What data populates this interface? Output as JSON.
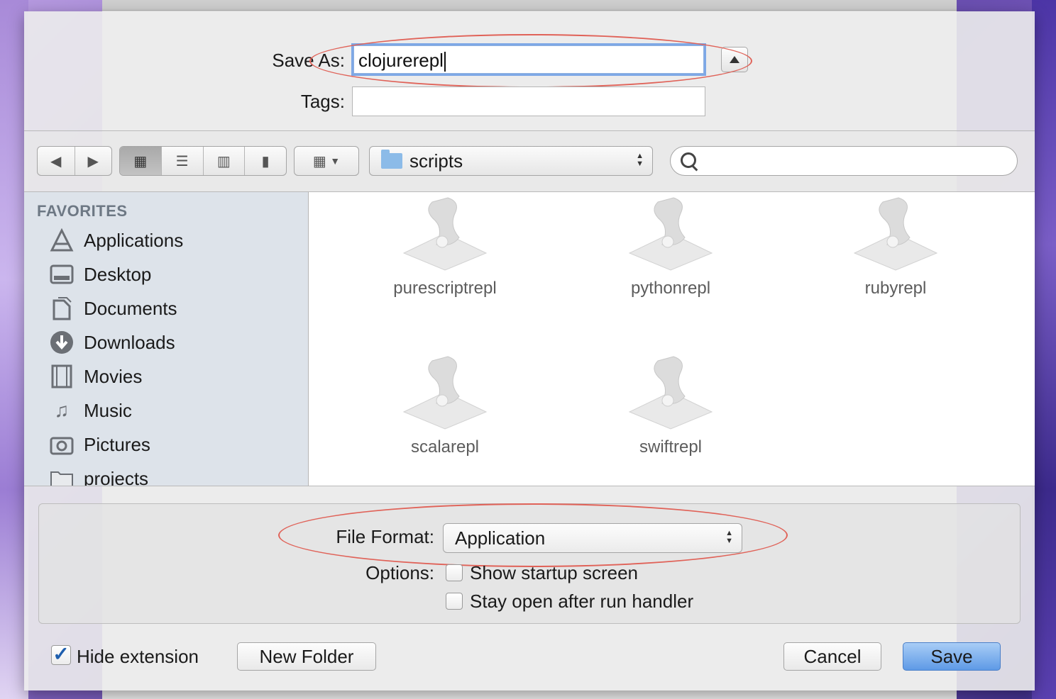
{
  "dialog": {
    "save_as_label": "Save As:",
    "save_as_value": "clojurerepl",
    "tags_label": "Tags:",
    "tags_value": ""
  },
  "toolbar": {
    "path_folder": "scripts",
    "search_placeholder": ""
  },
  "sidebar": {
    "header": "FAVORITES",
    "items": [
      {
        "label": "Applications",
        "icon": "applications-icon"
      },
      {
        "label": "Desktop",
        "icon": "desktop-icon"
      },
      {
        "label": "Documents",
        "icon": "documents-icon"
      },
      {
        "label": "Downloads",
        "icon": "downloads-icon"
      },
      {
        "label": "Movies",
        "icon": "movies-icon"
      },
      {
        "label": "Music",
        "icon": "music-icon"
      },
      {
        "label": "Pictures",
        "icon": "pictures-icon"
      },
      {
        "label": "projects",
        "icon": "folder-icon"
      }
    ]
  },
  "files": [
    {
      "name": "purescriptrepl"
    },
    {
      "name": "pythonrepl"
    },
    {
      "name": "rubyrepl"
    },
    {
      "name": "scalarepl"
    },
    {
      "name": "swiftrepl"
    }
  ],
  "format": {
    "label": "File Format:",
    "value": "Application",
    "options_label": "Options:",
    "option_startup": "Show startup screen",
    "option_stay_open": "Stay open after run handler"
  },
  "footer": {
    "hide_extension_label": "Hide extension",
    "hide_extension_checked": true,
    "new_folder_label": "New Folder",
    "cancel_label": "Cancel",
    "save_label": "Save"
  },
  "colors": {
    "annotation": "#e06258",
    "primary_button": "#5e9ae6",
    "sidebar_bg": "#dde3ea"
  }
}
